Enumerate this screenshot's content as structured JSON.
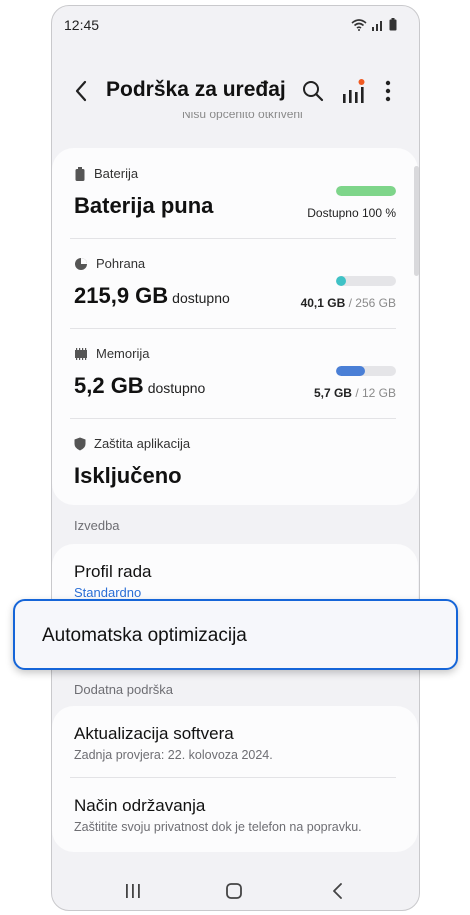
{
  "status_bar": {
    "time": "12:45"
  },
  "app_bar": {
    "title": "Podrška za uređaj"
  },
  "faded_header": "Nisu općenito otkriveni",
  "battery": {
    "label": "Baterija",
    "value": "Baterija puna",
    "caption": "Dostupno 100 %",
    "level": 1.0,
    "color": "#7ed58a"
  },
  "storage": {
    "label": "Pohrana",
    "value": "215,9 GB",
    "unit": "dostupno",
    "used": "40,1 GB",
    "total": "/ 256 GB",
    "level": 0.16,
    "color": "#3fc2c6"
  },
  "memory": {
    "label": "Memorija",
    "value": "5,2 GB",
    "unit": "dostupno",
    "used": "5,7 GB",
    "total": "/ 12 GB",
    "level": 0.475,
    "color": "#4a7fd6"
  },
  "app_protection": {
    "label": "Zaštita aplikacija",
    "value": "Isključeno"
  },
  "performance": {
    "header": "Izvedba",
    "title": "Profil rada",
    "subtitle": "Standardno"
  },
  "auto_optimization": {
    "label": "Automatska optimizacija"
  },
  "support": {
    "header": "Dodatna podrška",
    "items": [
      {
        "title": "Aktualizacija softvera",
        "subtitle": "Zadnja provjera: 22. kolovoza 2024."
      },
      {
        "title": "Način održavanja",
        "subtitle": "Zaštitite svoju privatnost dok je telefon na popravku."
      }
    ]
  },
  "colors": {
    "accent": "#2b6fd6",
    "highlight_border": "#1565d8",
    "notification_dot": "#f05a22"
  }
}
